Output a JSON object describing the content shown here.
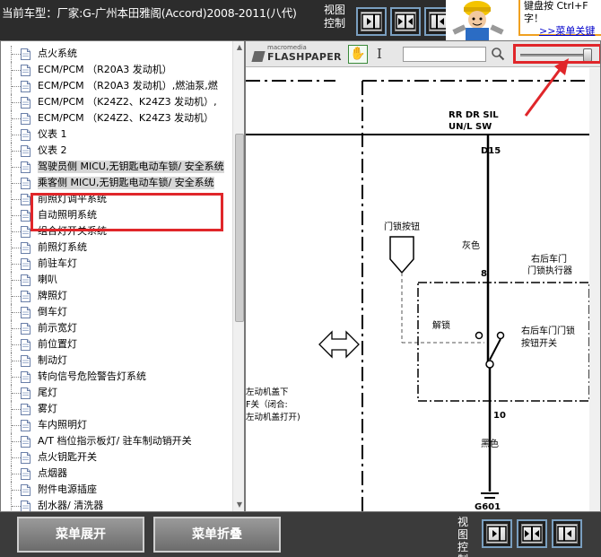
{
  "header": {
    "car_model": "当前车型：厂家:G-广州本田雅阁(Accord)2008-2011(八代)",
    "view_control_label": "视图控制"
  },
  "ad": {
    "line1": "键盘按  Ctrl+F",
    "line2": "字！",
    "link": ">>菜单关键"
  },
  "tree": {
    "items": [
      {
        "label": "点火系统"
      },
      {
        "label": "ECM/PCM （R20A3 发动机）"
      },
      {
        "label": "ECM/PCM （R20A3 发动机）,燃油泵,燃"
      },
      {
        "label": "ECM/PCM （K24Z2、K24Z3 发动机）,"
      },
      {
        "label": "ECM/PCM （K24Z2、K24Z3 发动机）"
      },
      {
        "label": "仪表 1"
      },
      {
        "label": "仪表 2"
      },
      {
        "label": "驾驶员侧 MICU,无钥匙电动车锁/ 安全系统"
      },
      {
        "label": "乘客侧 MICU,无钥匙电动车锁/ 安全系统"
      },
      {
        "label": "前照灯调平系统"
      },
      {
        "label": "自动照明系统"
      },
      {
        "label": "组合灯开关系统"
      },
      {
        "label": "前照灯系统"
      },
      {
        "label": "前驻车灯"
      },
      {
        "label": "喇叭"
      },
      {
        "label": "牌照灯"
      },
      {
        "label": "倒车灯"
      },
      {
        "label": "前示宽灯"
      },
      {
        "label": "前位置灯"
      },
      {
        "label": "制动灯"
      },
      {
        "label": "转向信号危险警告灯系统"
      },
      {
        "label": "尾灯"
      },
      {
        "label": "雾灯"
      },
      {
        "label": "车内照明灯"
      },
      {
        "label": "A/T 档位指示板灯/ 驻车制动销开关"
      },
      {
        "label": "点火钥匙开关"
      },
      {
        "label": "点烟器"
      },
      {
        "label": "附件电源插座"
      },
      {
        "label": "刮水器/ 清洗器"
      }
    ]
  },
  "viewer": {
    "brand_small": "macromedia",
    "brand": "FLASHPAPER",
    "search_value": "",
    "zoom_level": 0.92
  },
  "diagram": {
    "label_rr_dr": "RR DR SIL",
    "label_unl": "UN/L SW",
    "label_d15": "D15",
    "label_lock_btn": "门锁按钮",
    "label_gray": "灰色",
    "label_8": "8",
    "label_actuator_1": "右后车门",
    "label_actuator_2": "门锁执行器",
    "label_unlock": "解锁",
    "label_switch_1": "右后车门门锁",
    "label_switch_2": "按钮开关",
    "label_left_1": "左动机盖下",
    "label_left_2": "F关（闭合:",
    "label_left_3": "左动机盖打开)",
    "label_10": "10",
    "label_black": "黑色",
    "label_g601": "G601"
  },
  "footer": {
    "expand_label": "菜单展开",
    "collapse_label": "菜单折叠",
    "view_control_label": "视图控制"
  },
  "colors": {
    "accent_red": "#e0262a",
    "button_border": "#7a9fc0"
  }
}
